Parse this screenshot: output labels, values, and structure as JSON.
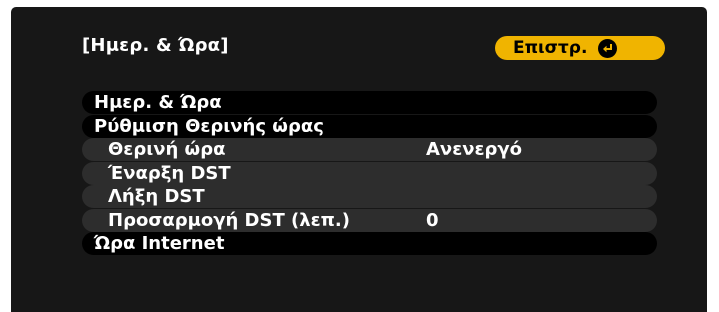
{
  "screen": {
    "title": "[Ημερ. & Ώρα]",
    "back_button": {
      "label": "Επιστρ.",
      "icon": "enter-icon"
    },
    "colors": {
      "background": "#171717",
      "row_selected": "#000000",
      "row_sub": "#2d2d2d",
      "back_button": "#f0b400",
      "text": "#ffffff"
    }
  },
  "menu": {
    "items": [
      {
        "label": "Ημερ. & Ώρα"
      },
      {
        "label": "Ρύθμιση Θερινής ώρας"
      },
      {
        "label": "Θερινή ώρα",
        "value": "Ανενεργό"
      },
      {
        "label": "Έναρξη DST"
      },
      {
        "label": "Λήξη DST"
      },
      {
        "label": "Προσαρμογή DST (λεπ.)",
        "value": "0"
      },
      {
        "label": "Ώρα Internet"
      }
    ]
  }
}
